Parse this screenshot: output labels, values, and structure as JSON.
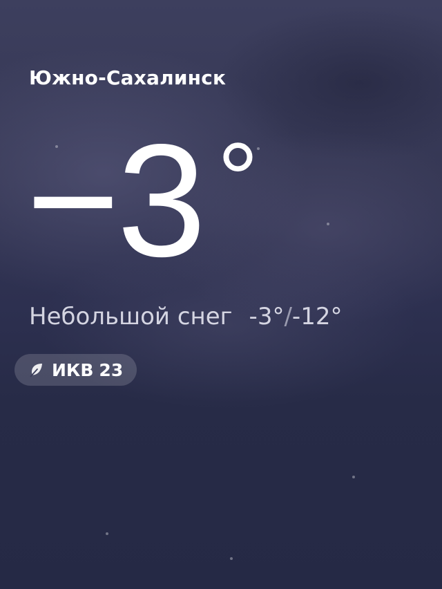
{
  "weather": {
    "city": "Южно-Сахалинск",
    "temperature": "−3",
    "degree_symbol": "°",
    "condition": "Небольшой снег",
    "high": "-3°",
    "separator": "/",
    "low": "-12°"
  },
  "aqi": {
    "icon": "leaf-icon",
    "label": "ИКВ",
    "value": "23"
  }
}
